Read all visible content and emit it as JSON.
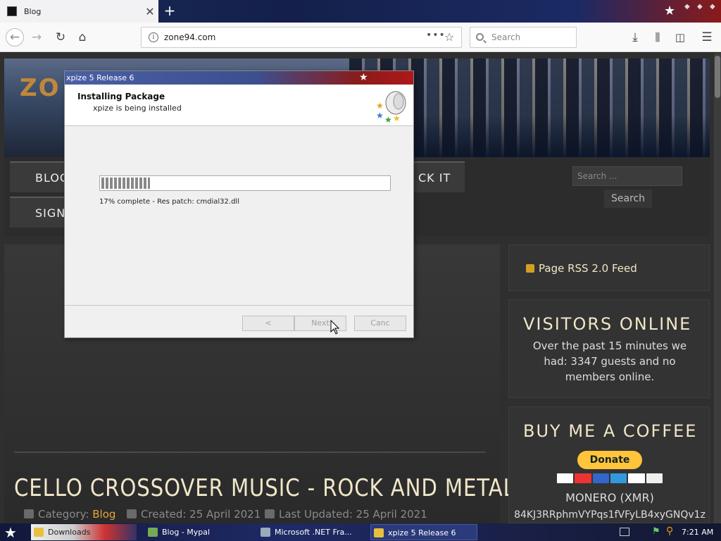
{
  "browser": {
    "tab_title": "Blog",
    "tab_close": "✕",
    "new_tab": "+",
    "url": "zone94.com",
    "url_more": "•••",
    "search_placeholder": "Search"
  },
  "site": {
    "logo": "ZO",
    "menu": {
      "blog": "BLOG",
      "sign": "SIGN",
      "rock": "CK IT"
    },
    "search_placeholder": "Search ...",
    "search_button": "Search",
    "article": {
      "title": "CELLO CROSSOVER MUSIC - ROCK AND METAL",
      "category_label": "Category:",
      "category": "Blog",
      "created": "Created: 25 April 2021",
      "updated": "Last Updated: 25 April 2021"
    },
    "sidebar": {
      "rss": "Page RSS 2.0 Feed",
      "visitors_title": "VISITORS ONLINE",
      "visitors_text": "Over the past 15 minutes we had: 3347 guests and no members online.",
      "coffee_title": "BUY ME A COFFEE",
      "donate": "Donate",
      "monero_label": "MONERO (XMR)",
      "monero_address": "84KJ3RRphmVYPqs1fVFyLB4xyGNQv1z"
    }
  },
  "installer": {
    "window_title": "xpize 5 Release 6",
    "heading": "Installing Package",
    "subheading": "xpize is being installed",
    "progress_percent": 17,
    "progress_text": "17% complete - Res patch: cmdial32.dll",
    "back_button": "<",
    "next_button": "Next",
    "cancel_button": "Canc"
  },
  "taskbar": {
    "tasks": [
      {
        "label": "Downloads"
      },
      {
        "label": "Blog - Mypal"
      },
      {
        "label": "Microsoft .NET Fra..."
      },
      {
        "label": "xpize 5 Release 6"
      }
    ],
    "clock": "7:21 AM"
  },
  "colors": {
    "accent_gold": "#e2a53a",
    "heading_cream": "#f1e6c8",
    "donate_yellow": "#ffc43a"
  }
}
